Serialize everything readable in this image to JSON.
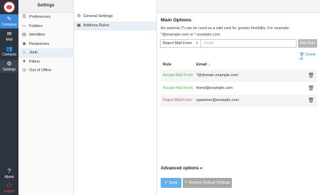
{
  "rail": {
    "compose": {
      "label": "Compose",
      "icon": "compose-icon"
    },
    "mail": {
      "label": "Mail",
      "icon": "mail-icon"
    },
    "contacts": {
      "label": "Contacts",
      "icon": "contacts-icon"
    },
    "settings": {
      "label": "Settings",
      "icon": "gear-icon"
    },
    "about": {
      "label": "About",
      "icon": "question-icon"
    },
    "logout": {
      "label": "Logout",
      "icon": "power-icon"
    }
  },
  "settings_nav": {
    "title": "Settings",
    "items": [
      {
        "label": "Preferences",
        "icon": "list-icon"
      },
      {
        "label": "Folders",
        "icon": "folder-icon"
      },
      {
        "label": "Identities",
        "icon": "id-card-icon"
      },
      {
        "label": "Responses",
        "icon": "chat-icon"
      },
      {
        "label": "Junk",
        "icon": "flame-icon"
      },
      {
        "label": "Filters",
        "icon": "filter-icon"
      },
      {
        "label": "Out of Office",
        "icon": "clock-icon"
      }
    ]
  },
  "junk_nav": {
    "items": [
      {
        "label": "General Settings",
        "icon": "gear-icon"
      },
      {
        "label": "Address Rules",
        "icon": "address-card-icon"
      }
    ]
  },
  "main": {
    "title": "Main Options",
    "description": "An asterisk (*) can be used as a wild card for greater flexibility. For example: *@example.com or *.example.com.",
    "rule_select_value": "Reject Mail From",
    "email_placeholder": "Email",
    "add_rule_label": "Add Rule",
    "delete_all_label": "Delete all",
    "table": {
      "col_rule": "Rule",
      "col_email": "Email",
      "rows": [
        {
          "rule": "Accept Mail From",
          "email": "*@domain.example.com",
          "type": "accept"
        },
        {
          "rule": "Accept Mail From",
          "email": "friend@example.com",
          "type": "accept"
        },
        {
          "rule": "Reject Mail From",
          "email": "spammer@example.com",
          "type": "reject"
        }
      ]
    },
    "advanced_label": "Advanced options",
    "save_label": "Save",
    "restore_label": "Restore Default Settings"
  },
  "colors": {
    "accent": "#3b8ad9",
    "accept": "#4caf50",
    "reject": "#d9534f",
    "rail": "#2c3440"
  }
}
